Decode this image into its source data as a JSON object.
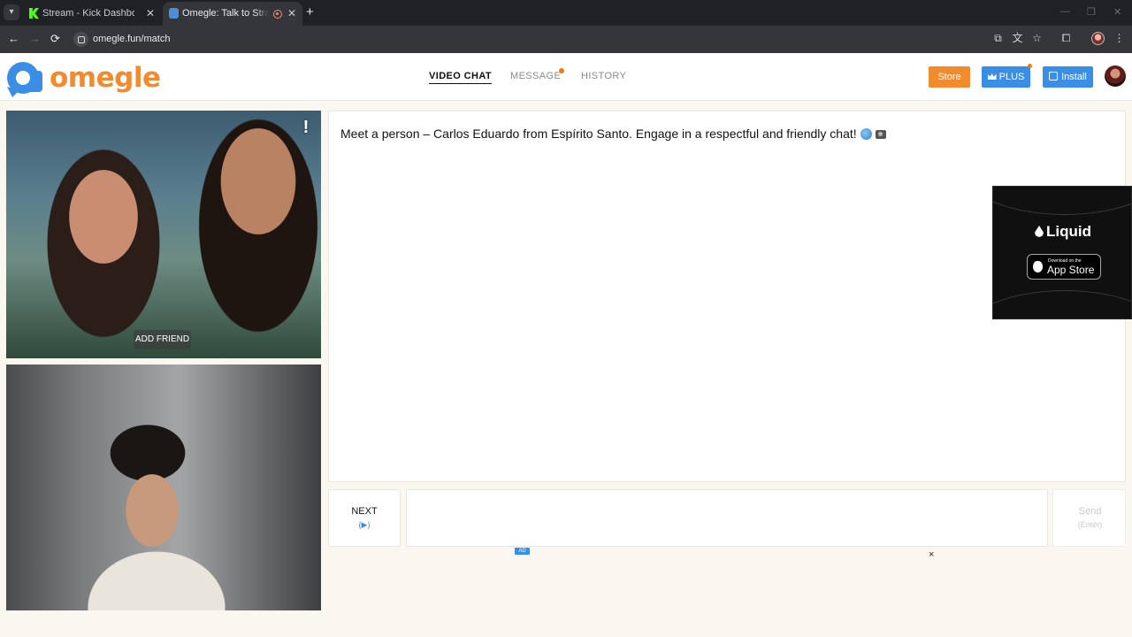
{
  "browser": {
    "tabs": [
      {
        "title": "Stream - Kick Dashboard",
        "close": "✕"
      },
      {
        "title": "Omegle: Talk to Strangers with",
        "close": "✕"
      }
    ],
    "new_tab": "+",
    "url": "omegle.fun/match",
    "nav": {
      "back": "←",
      "forward": "→",
      "reload": "⟳"
    },
    "window_controls": {
      "minimize": "—",
      "maximize": "❐",
      "close": "✕"
    }
  },
  "header": {
    "logo_text": "omegle",
    "nav": [
      {
        "label": "VIDEO CHAT",
        "active": true
      },
      {
        "label": "MESSAGE",
        "badge": true
      },
      {
        "label": "HISTORY"
      }
    ],
    "buttons": {
      "store": "Store",
      "plus": "PLUS",
      "install": "Install"
    },
    "colors": {
      "brand": "#f28a2e",
      "blue": "#3a8ee6"
    }
  },
  "stranger_video": {
    "report": "!",
    "add_friend": "ADD FRIEND"
  },
  "chat": {
    "intro": "Meet a person – Carlos Eduardo from Espírito Santo. Engage in a respectful and friendly chat!"
  },
  "ad": {
    "brand": "Liquid",
    "store_small": "Download on the",
    "store_big": "App Store",
    "badge": "AD",
    "close": "×"
  },
  "controls": {
    "next_label": "NEXT",
    "next_hint": "(▶)",
    "input_value": "",
    "send_label": "Send",
    "send_hint": "(Enter)"
  }
}
